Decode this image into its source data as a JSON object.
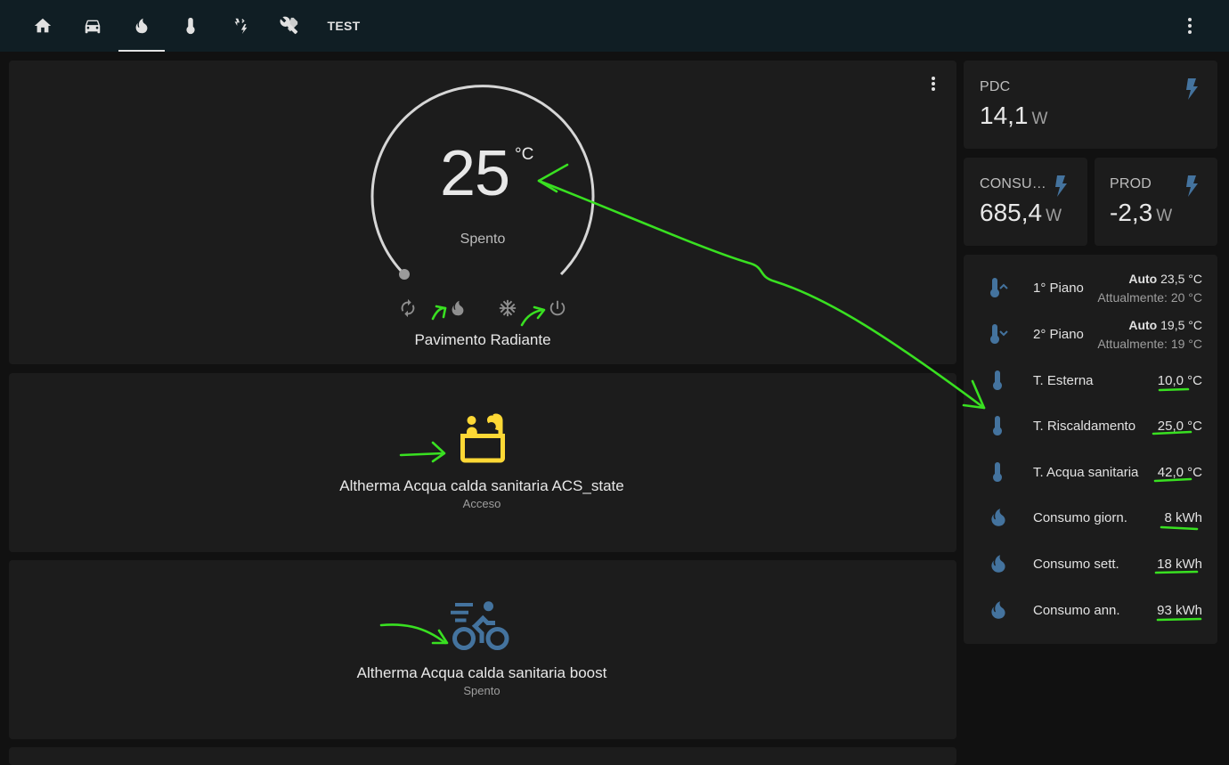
{
  "topbar": {
    "tabs": [
      {
        "icon": "home-icon"
      },
      {
        "icon": "car-icon"
      },
      {
        "icon": "fire-icon",
        "active": true
      },
      {
        "icon": "thermometer-icon"
      },
      {
        "icon": "weather-lightning-icon"
      },
      {
        "icon": "tools-icon"
      },
      {
        "label": "TEST"
      }
    ],
    "accent": "#e1e1e1",
    "background": "#101e24"
  },
  "thermostat": {
    "temperature": "25",
    "unit": "°C",
    "state": "Spento",
    "name": "Pavimento Radiante",
    "modes": [
      "auto-cycle-icon",
      "heat-fire-icon",
      "cool-snowflake-icon",
      "power-off-icon"
    ]
  },
  "entity1": {
    "name": "Altherma Acqua calda sanitaria ACS_state",
    "state": "Acceso",
    "icon": "hot-tub-icon",
    "icon_color": "#fdd835"
  },
  "entity2": {
    "name": "Altherma Acqua calda sanitaria boost",
    "state": "Spento",
    "icon": "bike-fast-icon",
    "icon_color": "#44739e"
  },
  "sensors": {
    "pdc": {
      "label": "PDC",
      "value": "14,1",
      "unit": "W"
    },
    "consumo": {
      "label": "CONSU…",
      "value": "685,4",
      "unit": "W"
    },
    "prod": {
      "label": "PROD",
      "value": "-2,3",
      "unit": "W"
    }
  },
  "entities_list": {
    "piano1": {
      "name": "1° Piano",
      "mode": "Auto",
      "target": "23,5 °C",
      "current": "Attualmente: 20 °C"
    },
    "piano2": {
      "name": "2° Piano",
      "mode": "Auto",
      "target": "19,5 °C",
      "current": "Attualmente: 19 °C"
    },
    "rows": [
      {
        "name": "T. Esterna",
        "value": "10,0 °C",
        "icon": "thermometer-icon"
      },
      {
        "name": "T. Riscaldamento",
        "value": "25,0 °C",
        "icon": "thermometer-icon"
      },
      {
        "name": "T. Acqua sanitaria",
        "value": "42,0 °C",
        "icon": "thermometer-icon"
      },
      {
        "name": "Consumo giorn.",
        "value": "8 kWh",
        "icon": "fire-icon"
      },
      {
        "name": "Consumo sett.",
        "value": "18 kWh",
        "icon": "fire-icon"
      },
      {
        "name": "Consumo ann.",
        "value": "93 kWh",
        "icon": "fire-icon"
      }
    ]
  },
  "colors": {
    "icon_blue": "#44739e",
    "card": "#1c1c1c",
    "annotation_green": "#39e021"
  }
}
